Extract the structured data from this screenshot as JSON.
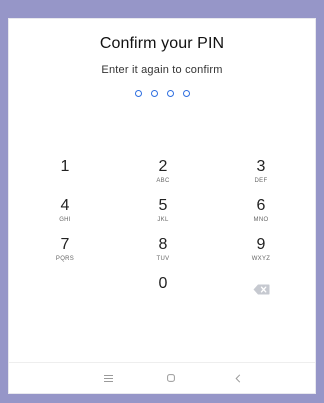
{
  "header": {
    "title": "Confirm your PIN",
    "subtitle": "Enter it again to confirm"
  },
  "pin": {
    "length": 4,
    "entered": 0,
    "dot_color": "#2f6fe0"
  },
  "keypad": {
    "keys": [
      {
        "digit": "1",
        "letters": ""
      },
      {
        "digit": "2",
        "letters": "ABC"
      },
      {
        "digit": "3",
        "letters": "DEF"
      },
      {
        "digit": "4",
        "letters": "GHI"
      },
      {
        "digit": "5",
        "letters": "JKL"
      },
      {
        "digit": "6",
        "letters": "MNO"
      },
      {
        "digit": "7",
        "letters": "PQRS"
      },
      {
        "digit": "8",
        "letters": "TUV"
      },
      {
        "digit": "9",
        "letters": "WXYZ"
      },
      {
        "digit": "0",
        "letters": ""
      }
    ],
    "backspace_icon": "backspace-icon"
  },
  "navbar": {
    "items": [
      "recent-apps-icon",
      "home-icon",
      "back-icon"
    ]
  },
  "colors": {
    "frame": "#9696c8",
    "screen": "#ffffff",
    "accent": "#2f6fe0"
  }
}
